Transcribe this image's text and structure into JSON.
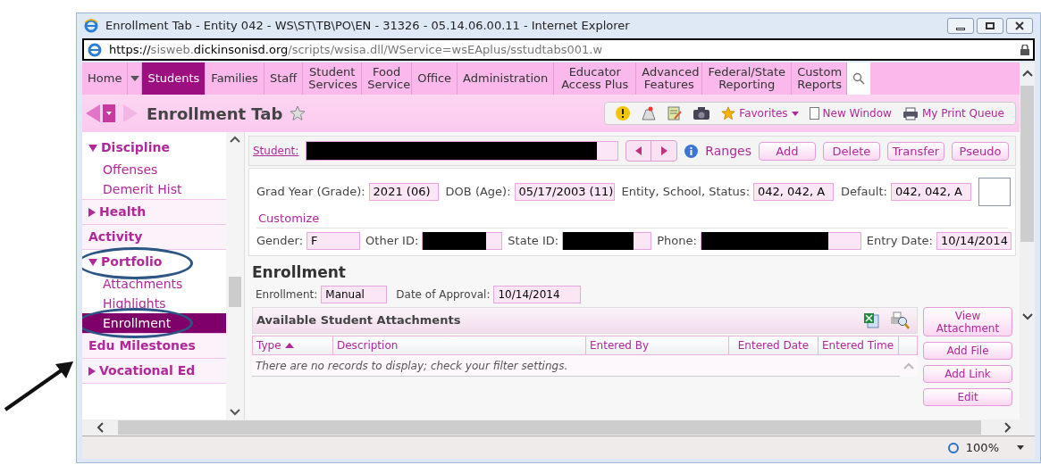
{
  "window": {
    "title": "Enrollment Tab - Entity 042 - WS\\ST\\TB\\PO\\EN - 31326 - 05.14.06.00.11 - Internet Explorer"
  },
  "address_bar": {
    "scheme": "https://",
    "host_prefix": "sisweb.",
    "host_domain": "dickinsonisd.org",
    "path": "/scripts/wsisa.dll/WService=wsEAplus/sstudtabs001.w"
  },
  "menu": [
    {
      "label": "Home",
      "selected": false
    },
    {
      "label": "Students",
      "selected": true
    },
    {
      "label": "Families",
      "selected": false
    },
    {
      "label": "Staff",
      "selected": false
    },
    {
      "label": "Student Services",
      "selected": false
    },
    {
      "label": "Food Service",
      "selected": false
    },
    {
      "label": "Office",
      "selected": false
    },
    {
      "label": "Administration",
      "selected": false
    },
    {
      "label": "Educator Access Plus",
      "selected": false
    },
    {
      "label": "Advanced Features",
      "selected": false
    },
    {
      "label": "Federal/State Reporting",
      "selected": false
    },
    {
      "label": "Custom Reports",
      "selected": false
    }
  ],
  "page_title": "Enrollment Tab",
  "toolbar": {
    "favorites": "Favorites",
    "new_window": "New Window",
    "print_queue": "My Print Queue"
  },
  "sidebar": [
    {
      "label": "Discipline",
      "expanded": true,
      "children": [
        {
          "label": "Offenses",
          "selected": false
        },
        {
          "label": "Demerit Hist",
          "selected": false
        }
      ]
    },
    {
      "label": "Health",
      "expanded": false
    },
    {
      "label": "Activity"
    },
    {
      "label": "Portfolio",
      "expanded": true,
      "children": [
        {
          "label": "Attachments",
          "selected": false
        },
        {
          "label": "Highlights",
          "selected": false
        },
        {
          "label": "Enrollment",
          "selected": true
        }
      ]
    },
    {
      "label": "Edu Milestones"
    },
    {
      "label": "Vocational Ed",
      "expanded": false
    }
  ],
  "student_bar": {
    "label": "Student:",
    "ranges": "Ranges",
    "buttons": [
      "Add",
      "Delete",
      "Transfer",
      "Pseudo"
    ]
  },
  "info_row_1": [
    {
      "label": "Grad Year (Grade):",
      "value": "2021 (06)"
    },
    {
      "label": "DOB (Age):",
      "value": "05/17/2003 (11)"
    },
    {
      "label": "Entity, School, Status:",
      "value": "042, 042, A"
    },
    {
      "label": "Default:",
      "value": "042, 042, A"
    }
  ],
  "customize": "Customize",
  "info_row_2": [
    {
      "label": "Gender:",
      "value": "F",
      "redacted": false
    },
    {
      "label": "Other ID:",
      "redacted": true
    },
    {
      "label": "State ID:",
      "redacted": true
    },
    {
      "label": "Phone:",
      "redacted": true
    },
    {
      "label": "Entry Date:",
      "value": "10/14/2014",
      "redacted": false
    }
  ],
  "section": {
    "title": "Enrollment",
    "fields": [
      {
        "label": "Enrollment:",
        "value": "Manual"
      },
      {
        "label": "Date of Approval:",
        "value": "10/14/2014"
      }
    ]
  },
  "attachments": {
    "title": "Available Student Attachments",
    "columns": [
      "Type",
      "Description",
      "Entered By",
      "Entered Date",
      "Entered Time"
    ],
    "empty_message": "There are no records to display; check your filter settings.",
    "buttons": [
      "View Attachment",
      "Add File",
      "Add Link",
      "Edit"
    ]
  },
  "status_bar": {
    "zoom": "100%"
  }
}
